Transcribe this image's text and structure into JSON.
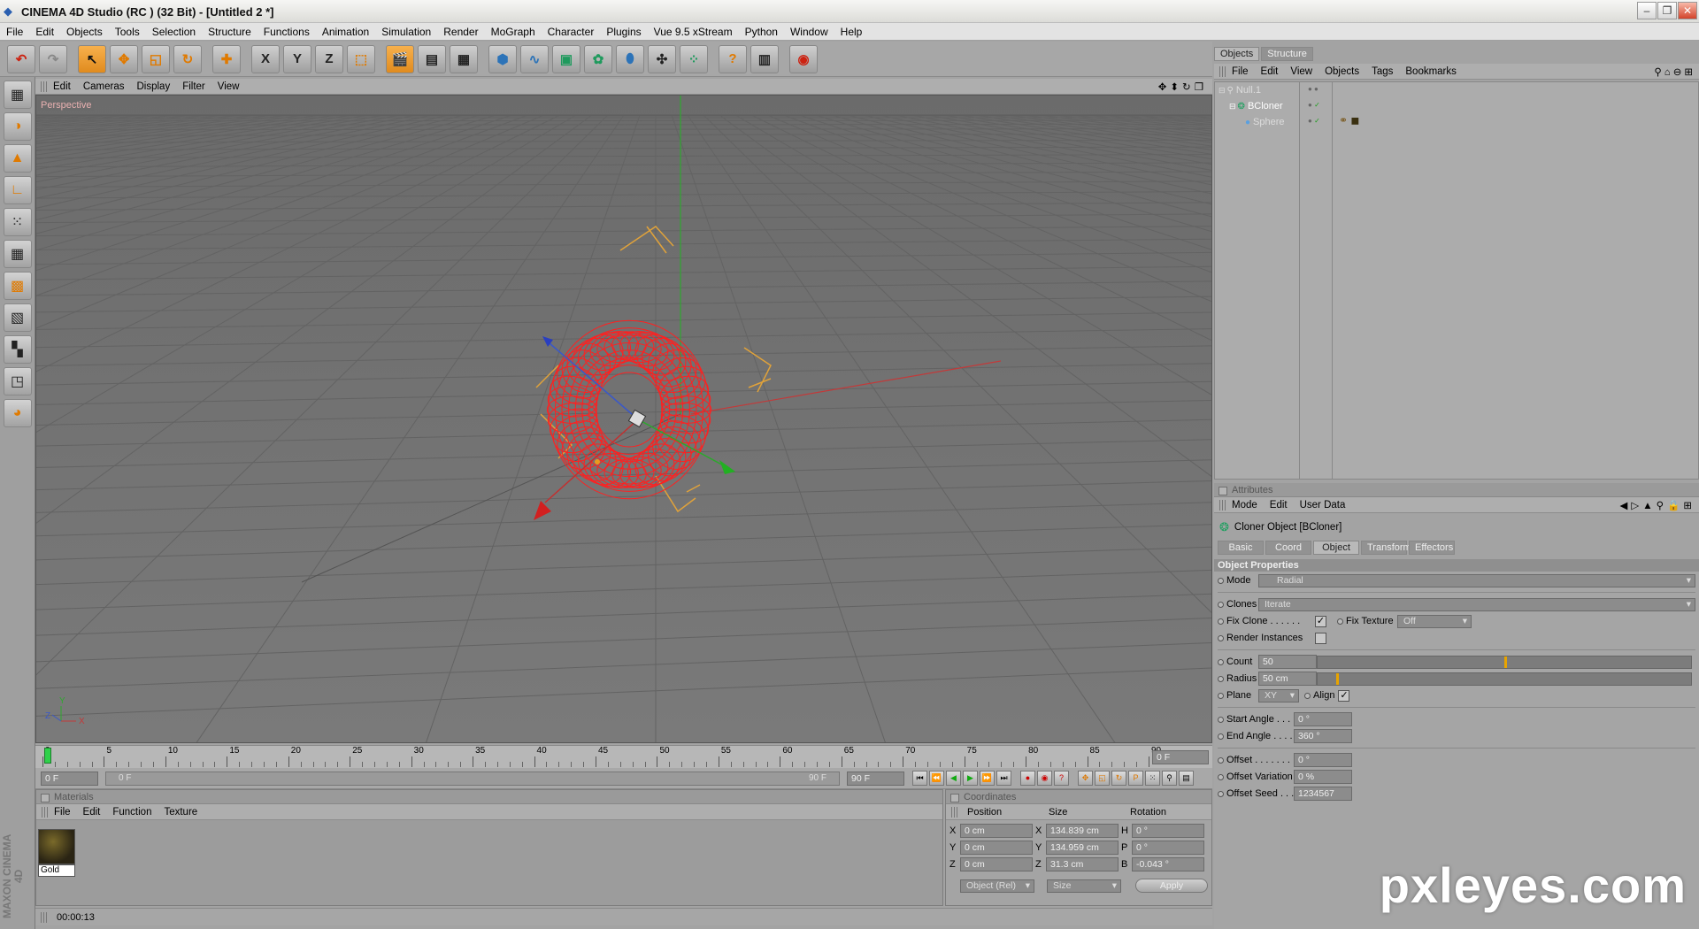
{
  "titlebar": {
    "title": "CINEMA 4D Studio (RC ) (32 Bit) - [Untitled 2 *]"
  },
  "menubar": [
    "File",
    "Edit",
    "Objects",
    "Tools",
    "Selection",
    "Structure",
    "Functions",
    "Animation",
    "Simulation",
    "Render",
    "MoGraph",
    "Character",
    "Plugins",
    "Vue 9.5 xStream",
    "Python",
    "Window",
    "Help"
  ],
  "toolbar": {
    "axis_x": "X",
    "axis_y": "Y",
    "axis_z": "Z",
    "icons": [
      "undo-icon",
      "redo-icon",
      "select-icon",
      "move-icon",
      "scale-icon",
      "rotate-icon",
      "add-icon",
      "x-axis-icon",
      "y-axis-icon",
      "z-axis-icon",
      "coordinate-icon",
      "render-view-icon",
      "render-picture-viewer-icon",
      "render-settings-icon",
      "cube-icon",
      "spline-icon",
      "nurbs-icon",
      "array-icon",
      "deformer-icon",
      "scene-icon",
      "effector-icon",
      "help-icon",
      "layout-icon",
      "browser-icon"
    ]
  },
  "viewport": {
    "menu": [
      "Edit",
      "Cameras",
      "Display",
      "Filter",
      "View"
    ],
    "label": "Perspective",
    "axis_labels": {
      "x": "X",
      "y": "Y",
      "z": "Z"
    }
  },
  "timeline": {
    "ticks": [
      "0",
      "5",
      "10",
      "15",
      "20",
      "25",
      "30",
      "35",
      "40",
      "45",
      "50",
      "55",
      "60",
      "65",
      "70",
      "75",
      "80",
      "85",
      "90"
    ],
    "current_frame": "0 F",
    "start_field": "0 F",
    "scrub_start": "0 F",
    "scrub_end": "90 F",
    "end_field": "90 F"
  },
  "materials": {
    "title": "Materials",
    "menu": [
      "File",
      "Edit",
      "Function",
      "Texture"
    ],
    "items": [
      {
        "name": "Gold"
      }
    ]
  },
  "coordinates": {
    "title": "Coordinates",
    "headers": {
      "position": "Position",
      "size": "Size",
      "rotation": "Rotation"
    },
    "rows": [
      {
        "axis": "X",
        "pos": "0 cm",
        "saxis": "X",
        "size": "134.839 cm",
        "raxis": "H",
        "rot": "0 °"
      },
      {
        "axis": "Y",
        "pos": "0 cm",
        "saxis": "Y",
        "size": "134.959 cm",
        "raxis": "P",
        "rot": "0 °"
      },
      {
        "axis": "Z",
        "pos": "0 cm",
        "saxis": "Z",
        "size": "31.3 cm",
        "raxis": "B",
        "rot": "-0.043 °"
      }
    ],
    "mode": "Object (Rel)",
    "size_mode": "Size",
    "apply": "Apply"
  },
  "statusbar": {
    "time": "00:00:13"
  },
  "objects_panel": {
    "tabs": [
      "Objects",
      "Structure"
    ],
    "menu": [
      "File",
      "Edit",
      "View",
      "Objects",
      "Tags",
      "Bookmarks"
    ],
    "tree": [
      {
        "name": "Null.1",
        "level": 0
      },
      {
        "name": "BCloner",
        "level": 1
      },
      {
        "name": "Sphere",
        "level": 2
      }
    ]
  },
  "attributes": {
    "title": "Attributes",
    "menu": [
      "Mode",
      "Edit",
      "User Data"
    ],
    "object_title": "Cloner Object [BCloner]",
    "tabs": [
      "Basic",
      "Coord",
      "Object",
      "Transform",
      "Effectors"
    ],
    "active_tab": "Object",
    "section": "Object Properties",
    "mode_label": "Mode",
    "mode_value": "Radial",
    "clones_label": "Clones",
    "clones_value": "Iterate",
    "fix_clone_label": "Fix Clone . . . . . .",
    "fix_texture_label": "Fix Texture",
    "fix_texture_value": "Off",
    "render_instances_label": "Render Instances",
    "count_label": "Count",
    "count_value": "50",
    "count_fraction": 0.5,
    "radius_label": "Radius",
    "radius_value": "50 cm",
    "radius_fraction": 0.05,
    "plane_label": "Plane",
    "plane_value": "XY",
    "align_label": "Align",
    "start_angle_label": "Start Angle . . .",
    "start_angle_value": "0 °",
    "end_angle_label": "End Angle . . . .",
    "end_angle_value": "360 °",
    "offset_label": "Offset . . . . . . . .",
    "offset_value": "0 °",
    "offset_variation_label": "Offset Variation",
    "offset_variation_value": "0 %",
    "offset_seed_label": "Offset Seed . . .",
    "offset_seed_value": "1234567"
  },
  "branding": {
    "vertical": "MAXON CINEMA 4D",
    "watermark": "pxleyes.com"
  },
  "colors": {
    "accent": "#e08b1e",
    "torus": "#ff2020",
    "viewport_bg": "#727272"
  }
}
